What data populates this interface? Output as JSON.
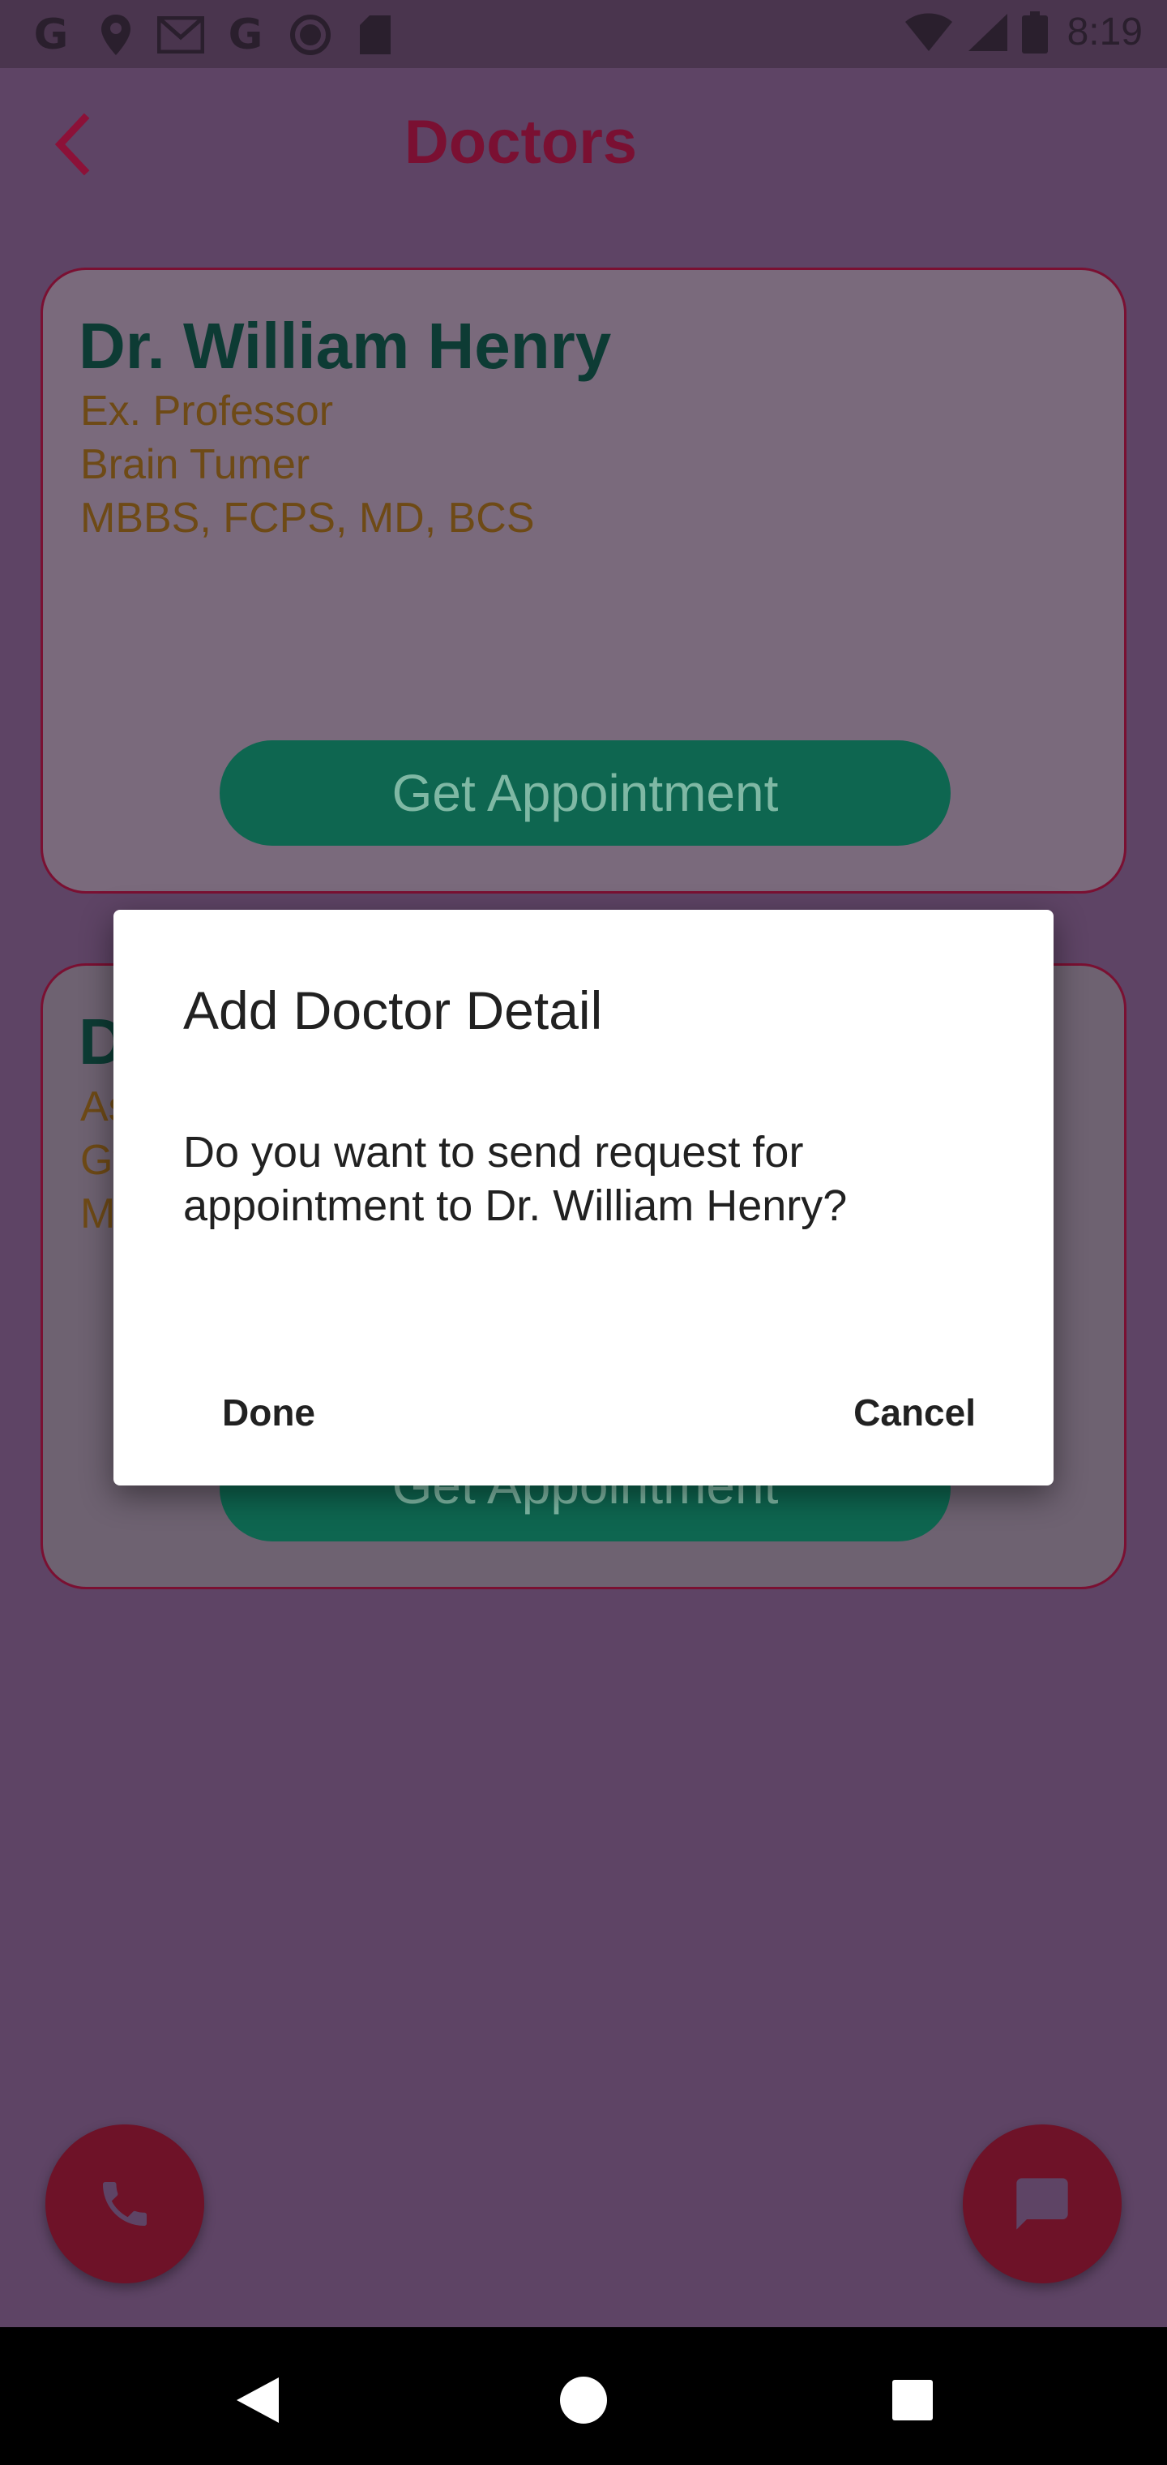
{
  "status_bar": {
    "left_icons": [
      "google-icon",
      "location-pin-icon",
      "gmail-icon",
      "google-icon",
      "circle-icon",
      "sd-card-icon"
    ],
    "right_icons": [
      "wifi-icon",
      "signal-icon",
      "battery-icon"
    ],
    "time": "8:19"
  },
  "app_bar": {
    "back_icon": "chevron-left-icon",
    "title": "Doctors"
  },
  "doctors": [
    {
      "name": "Dr. William Henry",
      "title": "Ex. Professor",
      "specialty": "Brain Tumer",
      "degrees": "MBBS, FCPS, MD, BCS",
      "button_label": "Get Appointment"
    },
    {
      "name": "D",
      "title": "As",
      "specialty": "Gy",
      "degrees": "M",
      "button_label": "Get Appointment"
    }
  ],
  "dialog": {
    "title": "Add Doctor Detail",
    "message": "Do you want to send request for appointment to Dr. William Henry?",
    "confirm_label": "Done",
    "cancel_label": "Cancel"
  },
  "fabs": {
    "call_icon": "phone-icon",
    "chat_icon": "chat-icon"
  },
  "colors": {
    "accent": "#c2185b",
    "title": "#7a1032",
    "doctor_name": "#0d3b34",
    "doctor_detail": "#6e4a16",
    "button": "#0e6650"
  },
  "nav_bar": {
    "back_icon": "triangle-back-icon",
    "home_icon": "circle-home-icon",
    "recents_icon": "square-recents-icon"
  }
}
